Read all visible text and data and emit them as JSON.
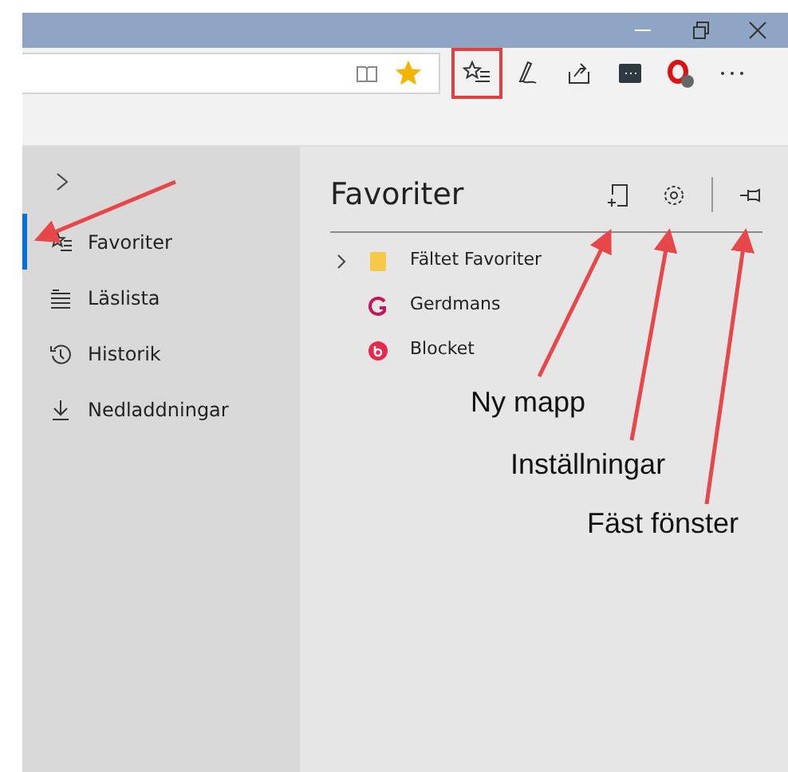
{
  "sidebar": {
    "items": [
      {
        "label": "Favoriter",
        "selected": true
      },
      {
        "label": "Läslista",
        "selected": false
      },
      {
        "label": "Historik",
        "selected": false
      },
      {
        "label": "Nedladdningar",
        "selected": false
      }
    ]
  },
  "favorites_panel": {
    "title": "Favoriter",
    "items": [
      {
        "label": "Fältet Favoriter",
        "kind": "folder",
        "expanded": false
      },
      {
        "label": "Gerdmans",
        "kind": "gerdmans"
      },
      {
        "label": "Blocket",
        "kind": "blocket"
      }
    ]
  },
  "annotations": [
    {
      "label": "Ny mapp"
    },
    {
      "label": "Inställningar"
    },
    {
      "label": "Fäst fönster"
    }
  ]
}
